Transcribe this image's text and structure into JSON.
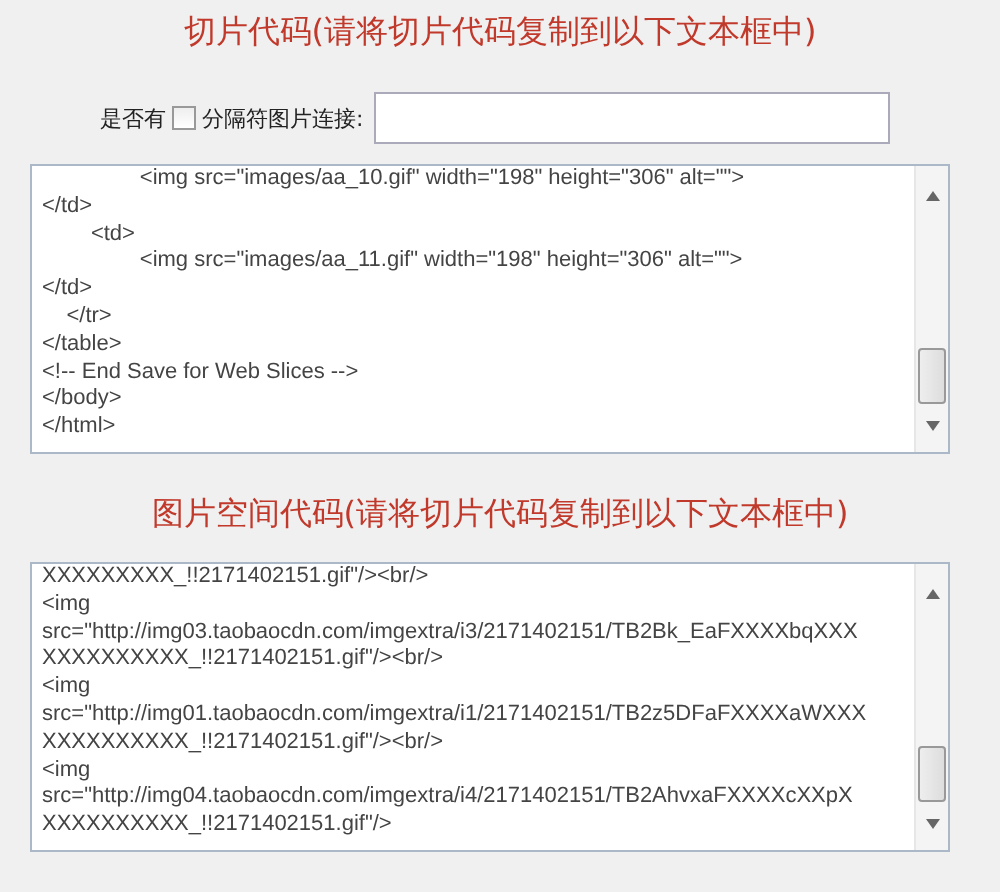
{
  "slice_section": {
    "title": "切片代码(请将切片代码复制到以下文本框中)",
    "option": {
      "prefix": "是否有",
      "checked": false,
      "label": "分隔符图片连接:"
    },
    "code_lines": [
      "\t\t\t\t<img src=\"images/aa_10.gif\" width=\"198\" height=\"306\" alt=\"\">",
      "</td>",
      "\t\t<td>",
      "\t\t\t\t<img src=\"images/aa_11.gif\" width=\"198\" height=\"306\" alt=\"\">",
      "</td>",
      "\t</tr>",
      "</table>",
      "<!-- End Save for Web Slices -->",
      "</body>",
      "</html>"
    ]
  },
  "space_section": {
    "title": "图片空间代码(请将切片代码复制到以下文本框中)",
    "code_lines": [
      "XXXXXXXXX_!!2171402151.gif\"/><br/>",
      "<img",
      "src=\"http://img03.taobaocdn.com/imgextra/i3/2171402151/TB2Bk_EaFXXXXbqXXX",
      "XXXXXXXXXX_!!2171402151.gif\"/><br/>",
      "<img",
      "src=\"http://img01.taobaocdn.com/imgextra/i1/2171402151/TB2z5DFaFXXXXaWXXX",
      "XXXXXXXXXX_!!2171402151.gif\"/><br/>",
      "<img",
      "src=\"http://img04.taobaocdn.com/imgextra/i4/2171402151/TB2AhvxaFXXXXcXXpX",
      "XXXXXXXXXX_!!2171402151.gif\"/>"
    ]
  }
}
